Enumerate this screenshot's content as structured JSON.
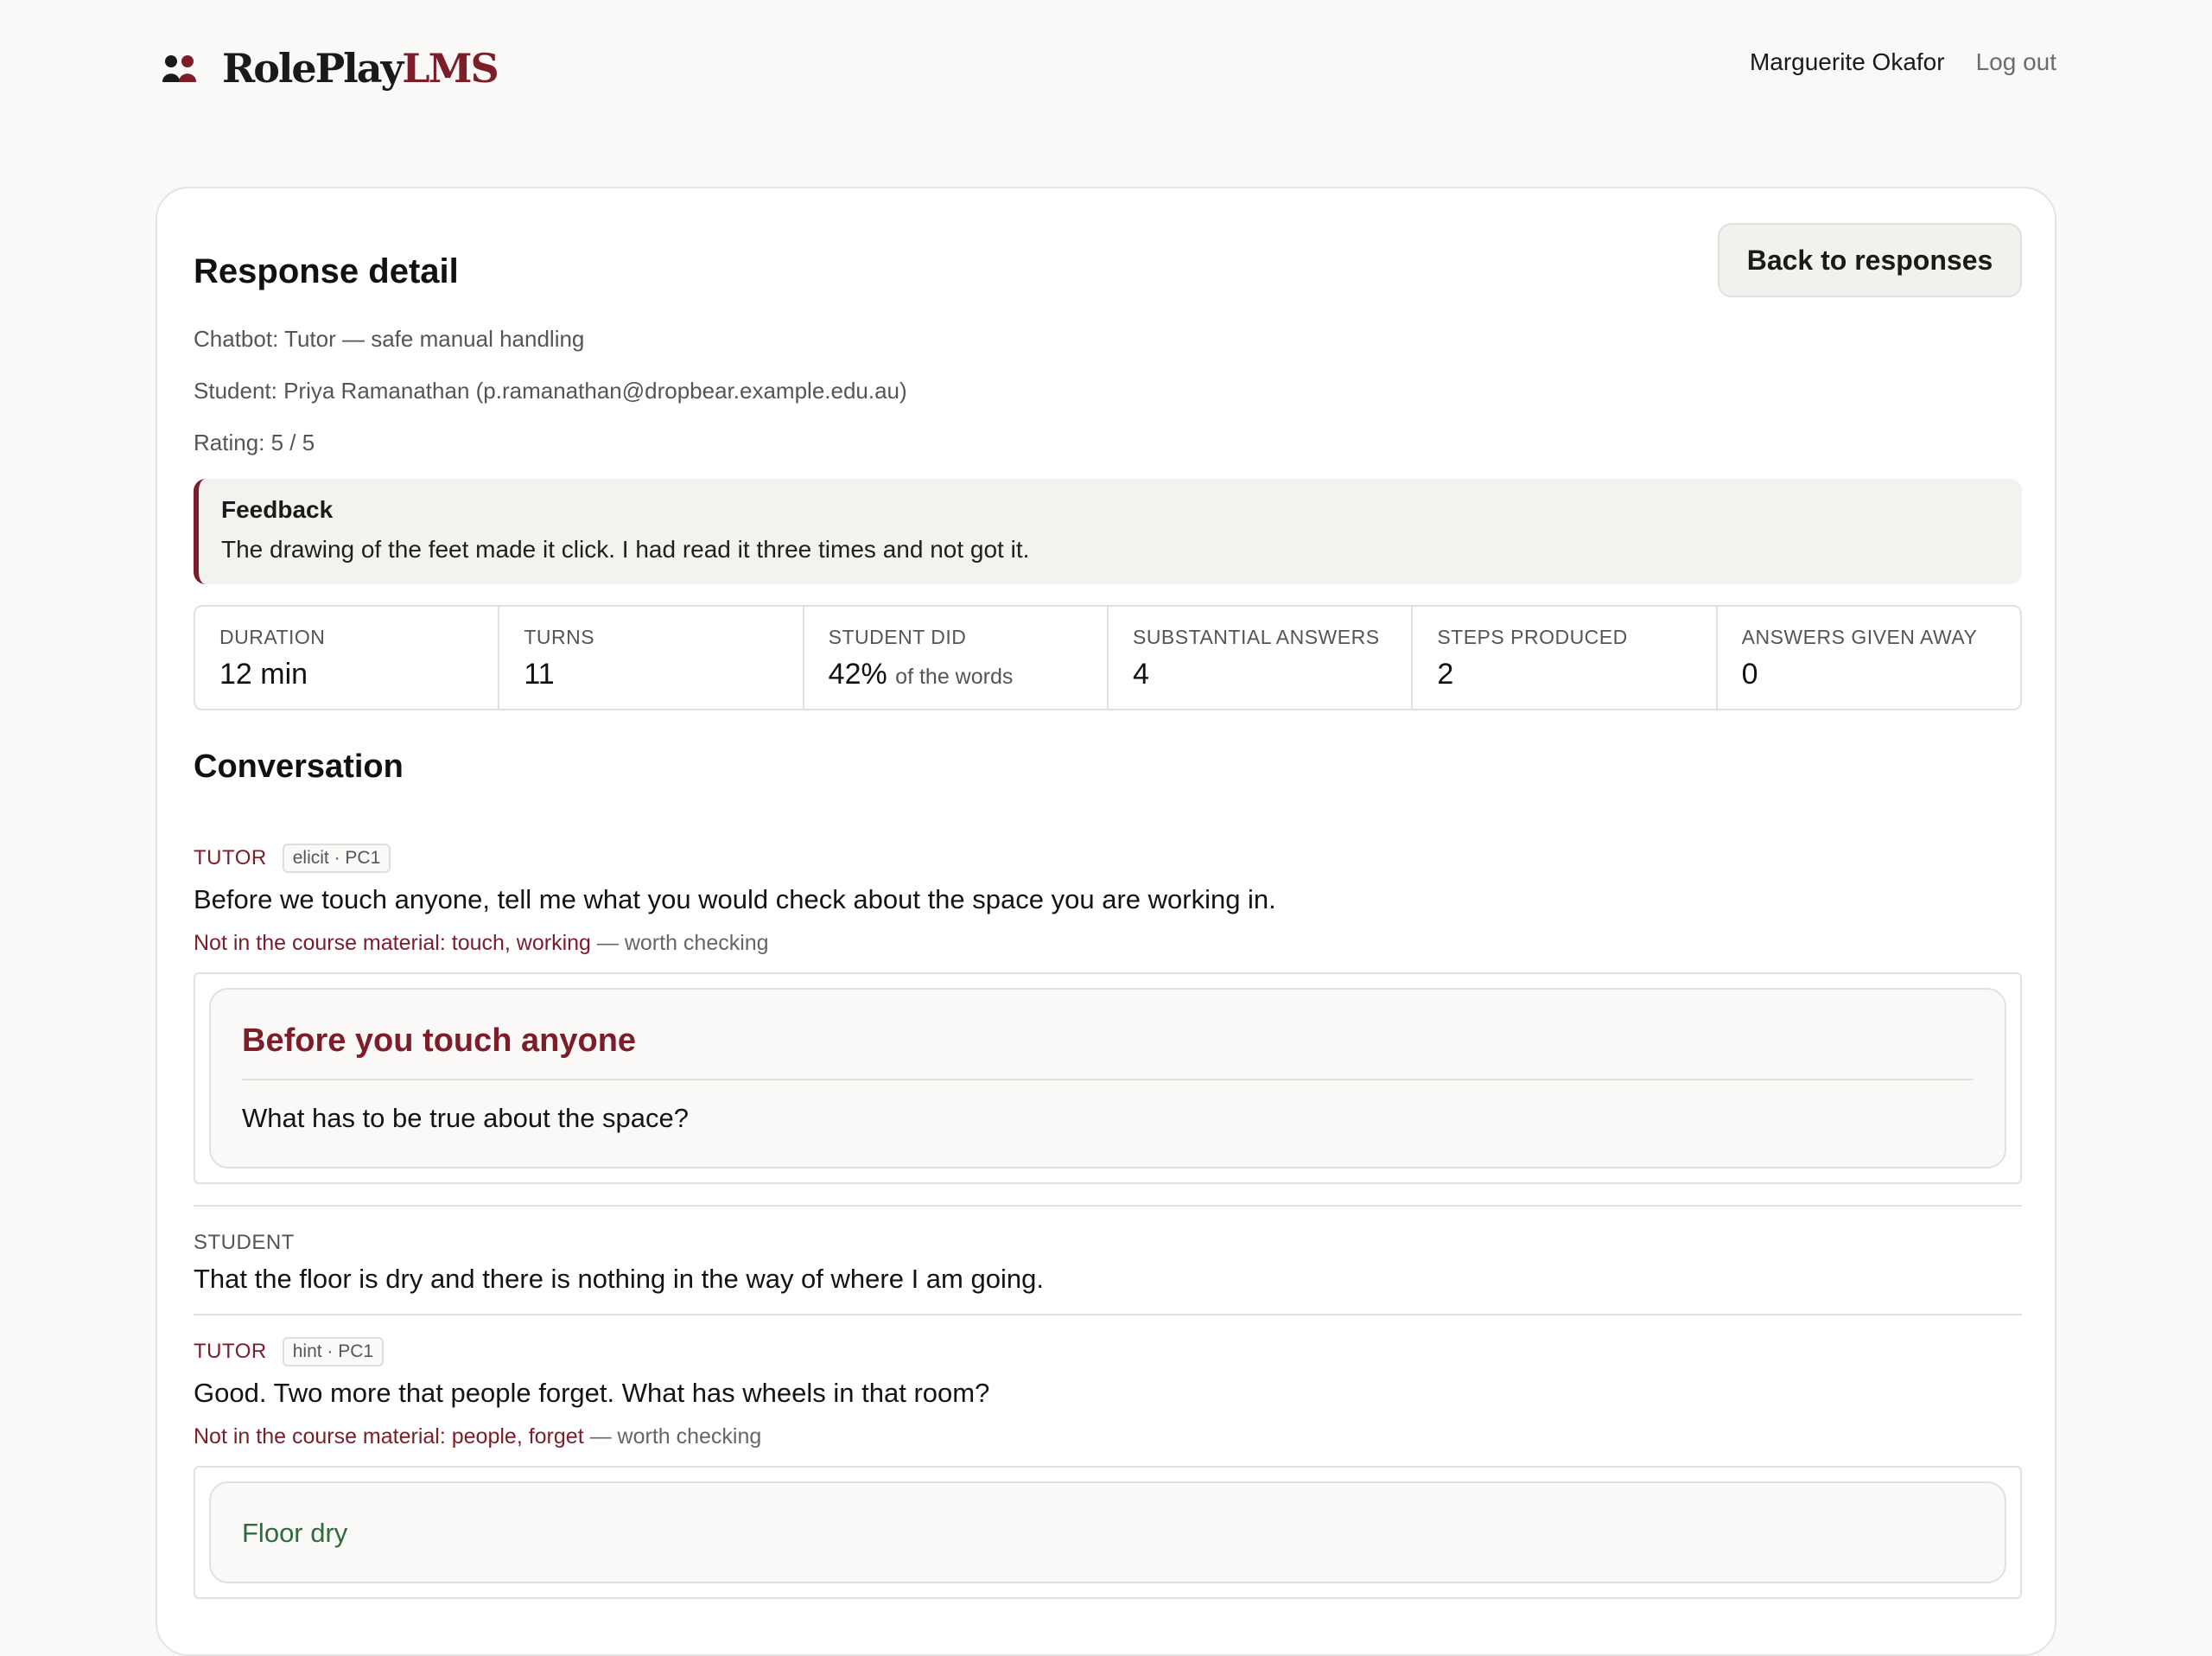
{
  "brand": {
    "name_main": "RolePlay",
    "name_accent": "LMS"
  },
  "user": {
    "name": "Marguerite Okafor",
    "logout": "Log out"
  },
  "page": {
    "title": "Response detail",
    "back_label": "Back to responses",
    "chatbot": "Chatbot: Tutor — safe manual handling",
    "student": "Student: Priya Ramanathan (p.ramanathan@dropbear.example.edu.au)",
    "rating": "Rating: 5 / 5"
  },
  "feedback": {
    "label": "Feedback",
    "text": "The drawing of the feet made it click. I had read it three times and not got it."
  },
  "stats": [
    {
      "label": "Duration",
      "value": "12 min",
      "suffix": ""
    },
    {
      "label": "Turns",
      "value": "11",
      "suffix": ""
    },
    {
      "label": "Student did",
      "value": "42%",
      "suffix": "of the words"
    },
    {
      "label": "Substantial answers",
      "value": "4",
      "suffix": ""
    },
    {
      "label": "Steps produced",
      "value": "2",
      "suffix": ""
    },
    {
      "label": "Answers given away",
      "value": "0",
      "suffix": ""
    }
  ],
  "conversation": {
    "title": "Conversation",
    "warning_suffix": "— worth checking",
    "messages": [
      {
        "role": "TUTOR",
        "tag": "elicit · PC1",
        "text": "Before we touch anyone, tell me what you would check about the space you are working in.",
        "warning": "Not in the course material: touch, working",
        "artifact_title": "Before you touch anyone",
        "artifact_text": "What has to be true about the space?"
      },
      {
        "role": "STUDENT",
        "text": "That the floor is dry and there is nothing in the way of where I am going."
      },
      {
        "role": "TUTOR",
        "tag": "hint · PC1",
        "text": "Good. Two more that people forget. What has wheels in that room?",
        "warning": "Not in the course material: people, forget",
        "artifact_item": "Floor dry"
      }
    ]
  },
  "colors": {
    "accent": "#7c1d2a",
    "success": "#2d6b3c",
    "background": "#faf9f7"
  }
}
